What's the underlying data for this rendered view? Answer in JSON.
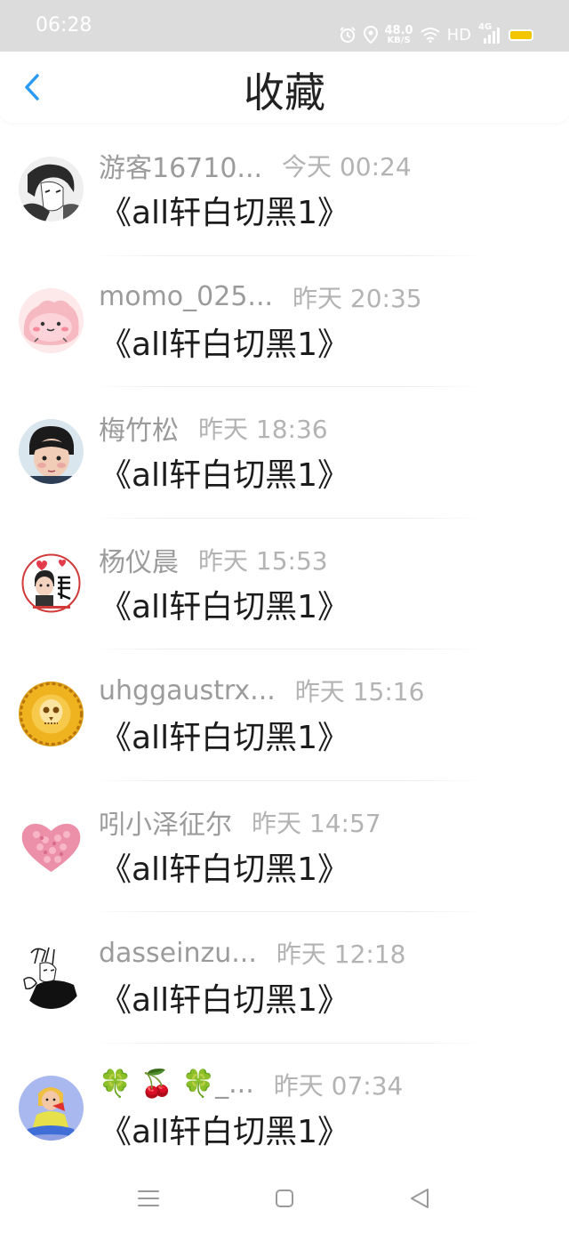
{
  "status_bar": {
    "time": "06:28",
    "net_speed_value": "48.0",
    "net_speed_unit": "KB/S",
    "hd_label": "HD",
    "network_label": "4G",
    "battery_color": "#f2c500",
    "icons": [
      "alarm-icon",
      "location-icon",
      "wifi-icon",
      "signal-icon",
      "battery-icon"
    ]
  },
  "header": {
    "title": "收藏",
    "back_icon": "chevron-left-icon",
    "accent_color": "#2b9af3"
  },
  "items": [
    {
      "user": "游客16710...",
      "time": "今天 00:24",
      "title": "《all轩白切黑1》"
    },
    {
      "user": "momo_025...",
      "time": "昨天 20:35",
      "title": "《all轩白切黑1》"
    },
    {
      "user": "梅竹松",
      "time": "昨天 18:36",
      "title": "《all轩白切黑1》"
    },
    {
      "user": "杨仪晨",
      "time": "昨天 15:53",
      "title": "《all轩白切黑1》"
    },
    {
      "user": "uhggaustrx...",
      "time": "昨天 15:16",
      "title": "《all轩白切黑1》"
    },
    {
      "user": "吲小泽征尔",
      "time": "昨天 14:57",
      "title": "《all轩白切黑1》"
    },
    {
      "user": "dasseinzu...",
      "time": "昨天 12:18",
      "title": "《all轩白切黑1》"
    },
    {
      "user": "🍀 🍒 🍀_...",
      "time": "昨天 07:34",
      "title": "《all轩白切黑1》"
    }
  ],
  "nav_bar": {
    "icons": [
      "menu-icon",
      "home-square-icon",
      "back-triangle-icon"
    ]
  }
}
